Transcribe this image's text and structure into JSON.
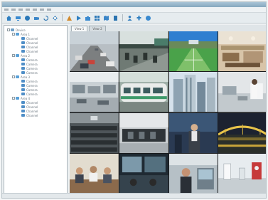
{
  "app": {
    "title": ""
  },
  "menu": {
    "items": [
      "",
      "",
      "",
      "",
      "",
      "",
      ""
    ]
  },
  "toolbar": {
    "tools": [
      {
        "icon": "home-icon",
        "color": "#2f7fc1"
      },
      {
        "icon": "monitor-icon",
        "color": "#3a8ad0"
      },
      {
        "icon": "record-icon",
        "color": "#2b78b8"
      },
      {
        "icon": "camera-icon",
        "color": "#3b86c8"
      },
      {
        "icon": "refresh-icon",
        "color": "#2a73b0"
      },
      {
        "icon": "ptz-icon",
        "color": "#3780bf"
      },
      {
        "icon": "alarm-icon",
        "color": "#d28a2c"
      },
      {
        "icon": "playback-icon",
        "color": "#2f7fc1"
      },
      {
        "icon": "snapshot-icon",
        "color": "#3a8ad0"
      },
      {
        "icon": "layout-icon",
        "color": "#2b78b8"
      },
      {
        "icon": "map-icon",
        "color": "#3b86c8"
      },
      {
        "icon": "log-icon",
        "color": "#2a73b0"
      },
      {
        "icon": "user-icon",
        "color": "#3780bf"
      },
      {
        "icon": "config-icon",
        "color": "#2f7fc1"
      },
      {
        "icon": "help-icon",
        "color": "#3a8ad0"
      }
    ]
  },
  "tree": {
    "root": "Device",
    "groups": [
      {
        "name": "Area 1",
        "cameras": [
          "Channel",
          "Channel",
          "Channel",
          "Channel"
        ]
      },
      {
        "name": "Area 2",
        "cameras": [
          "Camera",
          "Camera",
          "Camera",
          "Camera"
        ]
      },
      {
        "name": "Area 3",
        "cameras": [
          "Camera",
          "Camera",
          "Camera",
          "Camera"
        ]
      },
      {
        "name": "Area 4",
        "cameras": [
          "Channel",
          "Channel",
          "Channel",
          "Channel"
        ]
      }
    ]
  },
  "view": {
    "tabs": [
      "View 1",
      "View 2"
    ]
  },
  "status": {
    "text": ""
  }
}
